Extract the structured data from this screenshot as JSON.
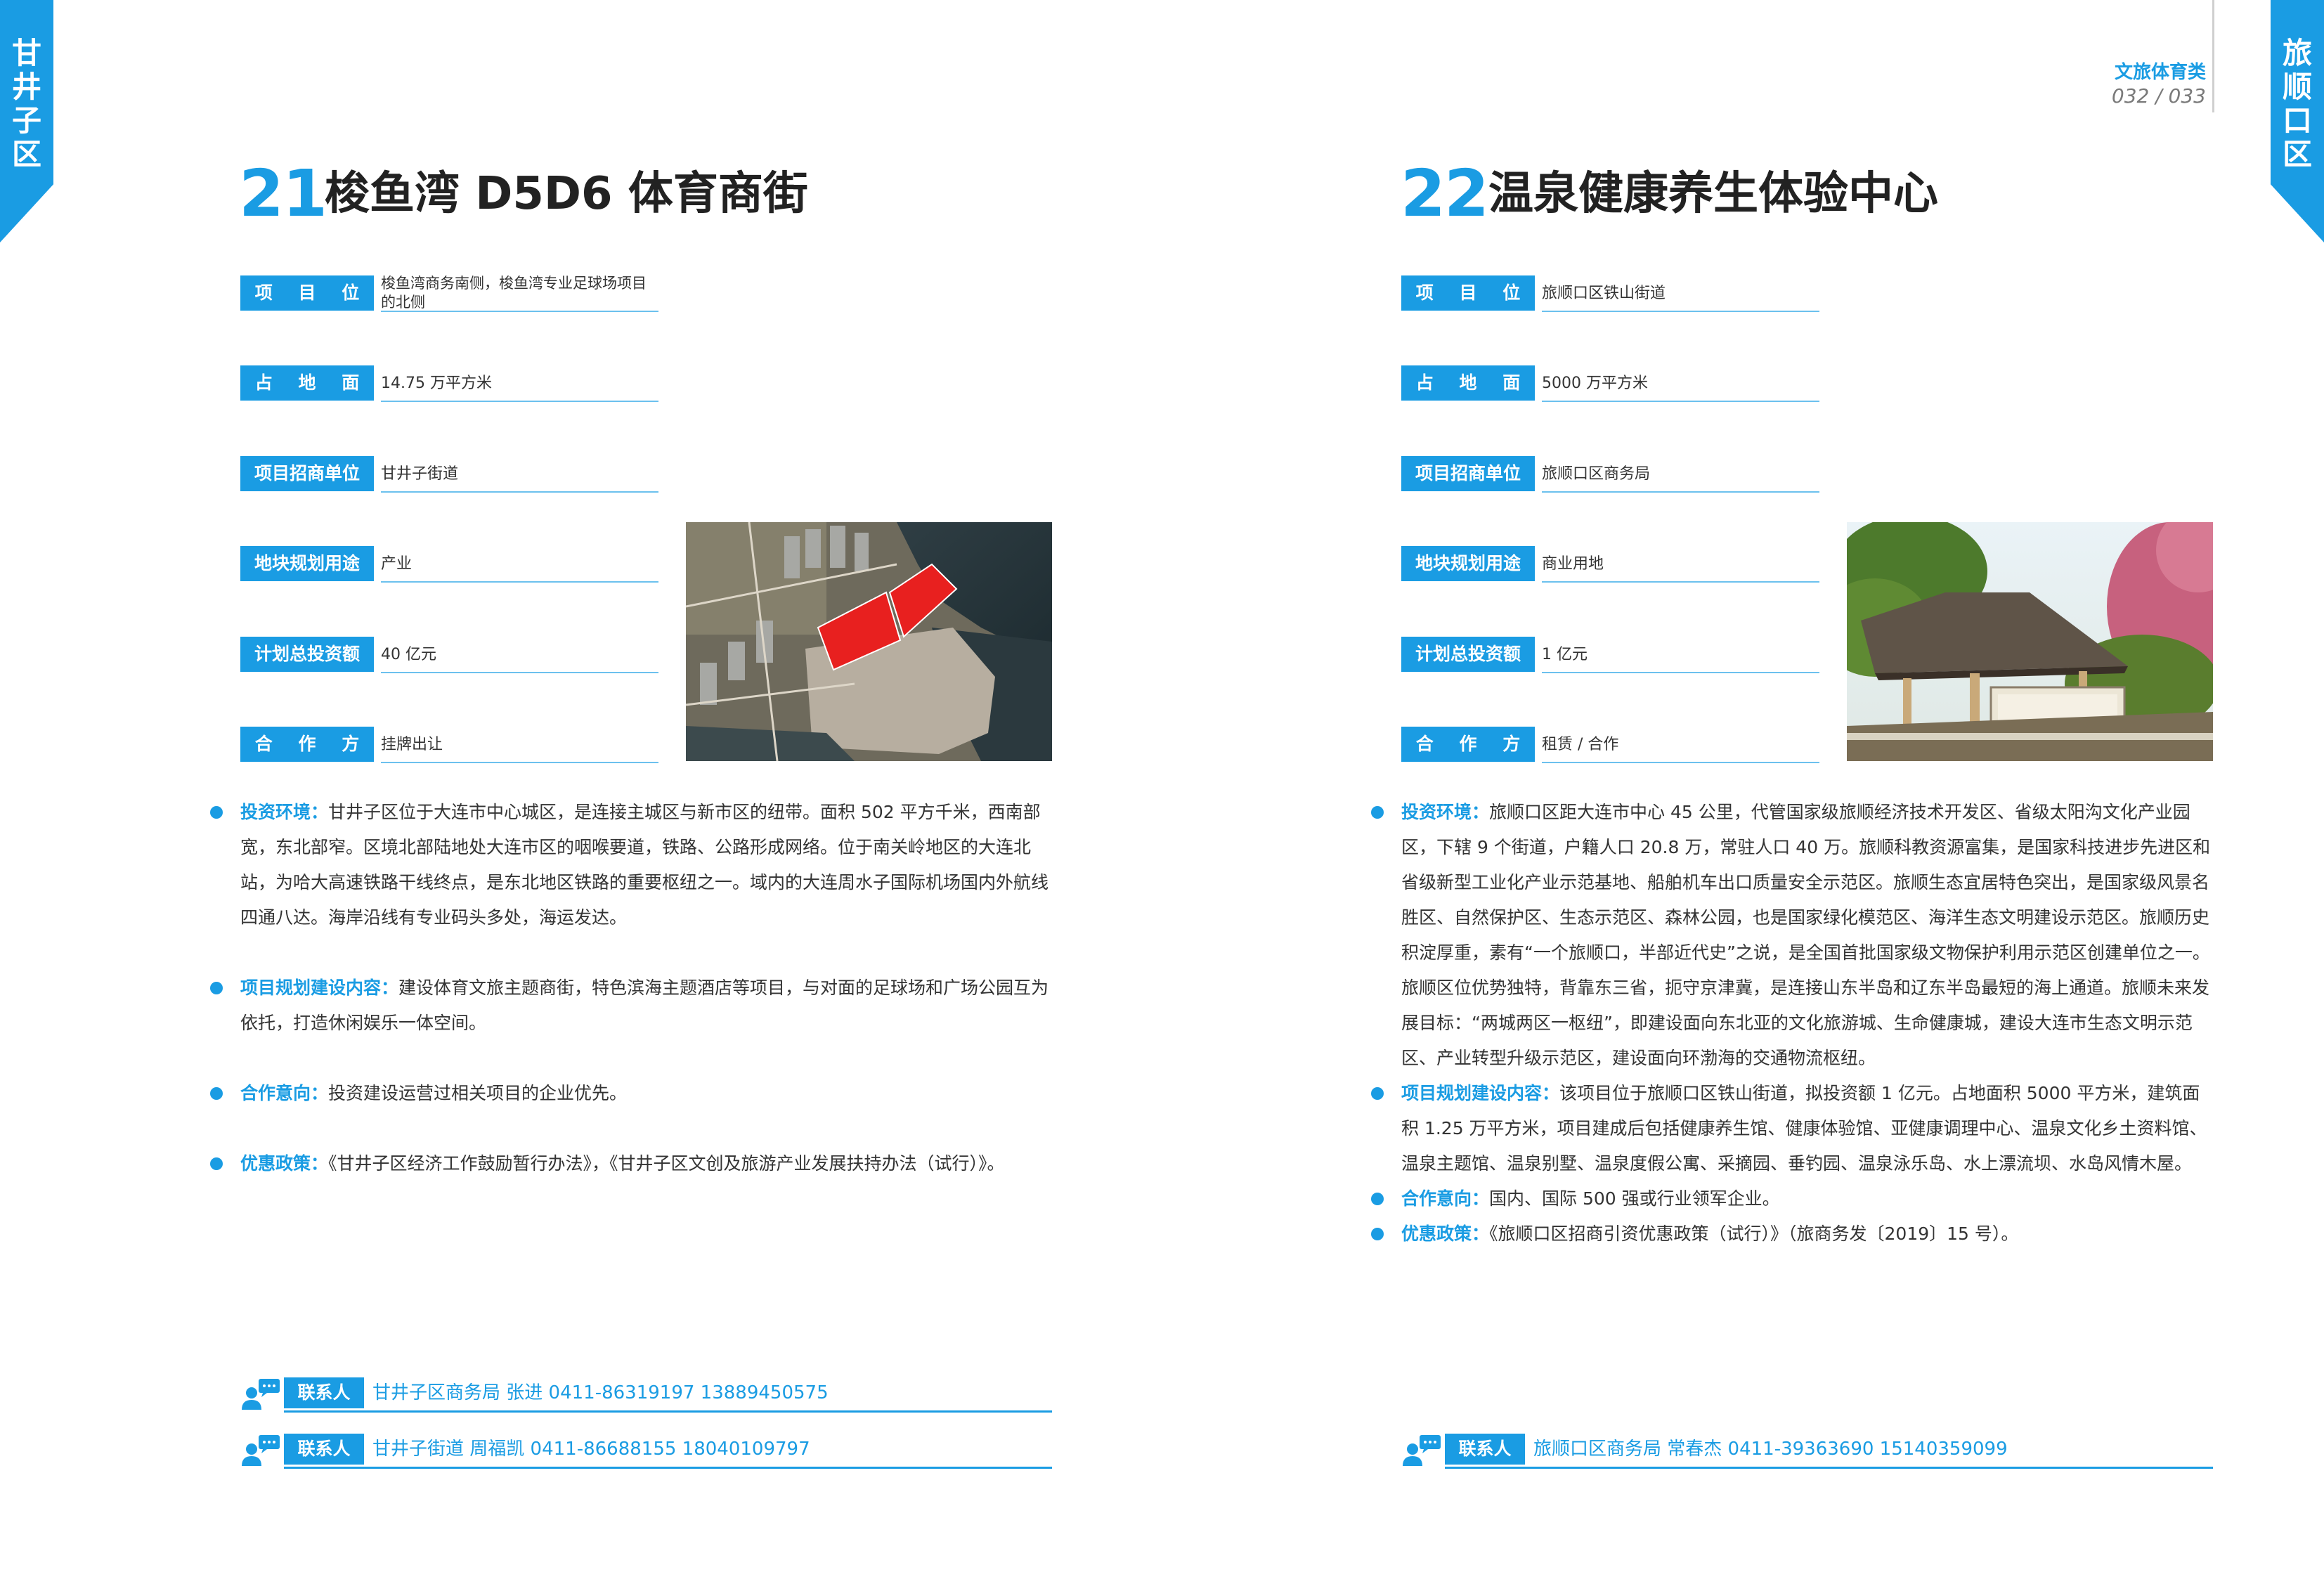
{
  "tabs": {
    "left": [
      "甘",
      "井",
      "子",
      "区"
    ],
    "right": [
      "旅",
      "顺",
      "口",
      "区"
    ]
  },
  "header": {
    "category": "文旅体育类",
    "page_numbers": "032 / 033"
  },
  "colors": {
    "accent": "#1a9ce3",
    "highlight_red": "#e8201f"
  },
  "left": {
    "number": "21",
    "title": "梭鱼湾 D5D6 体育商街",
    "rows": [
      {
        "label": "项 目 位 置",
        "value": "梭鱼湾商务南侧，梭鱼湾专业足球场项目的北侧"
      },
      {
        "label": "占 地 面 积",
        "value": "14.75 万平方米"
      },
      {
        "label": "项目招商单位",
        "value": "甘井子街道"
      },
      {
        "label": "地块规划用途",
        "value": "产业"
      },
      {
        "label": "计划总投资额",
        "value": "40 亿元"
      },
      {
        "label": "合 作 方 式",
        "value": "挂牌出让"
      }
    ],
    "bullets": [
      {
        "key": "投资环境：",
        "text": "甘井子区位于大连市中心城区，是连接主城区与新市区的纽带。面积 502 平方千米，西南部宽，东北部窄。区境北部陆地处大连市区的咽喉要道，铁路、公路形成网络。位于南关岭地区的大连北站，为哈大高速铁路干线终点，是东北地区铁路的重要枢纽之一。域内的大连周水子国际机场国内外航线四通八达。海岸沿线有专业码头多处，海运发达。"
      },
      {
        "key": "项目规划建设内容：",
        "text": "建设体育文旅主题商街，特色滨海主题酒店等项目，与对面的足球场和广场公园互为依托，打造休闲娱乐一体空间。"
      },
      {
        "key": "合作意向：",
        "text": "投资建设运营过相关项目的企业优先。"
      },
      {
        "key": "优惠政策：",
        "text": "《甘井子区经济工作鼓励暂行办法》，《甘井子区文创及旅游产业发展扶持办法（试行）》。"
      }
    ],
    "contacts": [
      {
        "label": "联系人",
        "text": "甘井子区商务局  张进  0411-86319197  13889450575"
      },
      {
        "label": "联系人",
        "text": "甘井子街道  周福凯  0411-86688155  18040109797"
      }
    ]
  },
  "right": {
    "number": "22",
    "title": "温泉健康养生体验中心",
    "rows": [
      {
        "label": "项 目 位 置",
        "value": "旅顺口区铁山街道"
      },
      {
        "label": "占 地 面 积",
        "value": "5000 万平方米"
      },
      {
        "label": "项目招商单位",
        "value": "旅顺口区商务局"
      },
      {
        "label": "地块规划用途",
        "value": "商业用地"
      },
      {
        "label": "计划总投资额",
        "value": "1 亿元"
      },
      {
        "label": "合 作 方 式",
        "value": "租赁 / 合作"
      }
    ],
    "bullets": [
      {
        "key": "投资环境：",
        "text": "旅顺口区距大连市中心 45 公里，代管国家级旅顺经济技术开发区、省级太阳沟文化产业园区，下辖 9 个街道，户籍人口 20.8 万，常驻人口 40 万。旅顺科教资源富集，是国家科技进步先进区和省级新型工业化产业示范基地、船舶机车出口质量安全示范区。旅顺生态宜居特色突出，是国家级风景名胜区、自然保护区、生态示范区、森林公园，也是国家绿化模范区、海洋生态文明建设示范区。旅顺历史积淀厚重，素有“一个旅顺口，半部近代史”之说，是全国首批国家级文物保护利用示范区创建单位之一。旅顺区位优势独特，背靠东三省，扼守京津冀，是连接山东半岛和辽东半岛最短的海上通道。旅顺未来发展目标：“两城两区一枢纽”，即建设面向东北亚的文化旅游城、生命健康城，建设大连市生态文明示范区、产业转型升级示范区，建设面向环渤海的交通物流枢纽。"
      },
      {
        "key": "项目规划建设内容：",
        "text": "该项目位于旅顺口区铁山街道，拟投资额 1 亿元。占地面积 5000 平方米，建筑面积 1.25 万平方米，项目建成后包括健康养生馆、健康体验馆、亚健康调理中心、温泉文化乡土资料馆、温泉主题馆、温泉别墅、温泉度假公寓、采摘园、垂钓园、温泉泳乐岛、水上漂流坝、水岛风情木屋。"
      },
      {
        "key": "合作意向：",
        "text": "国内、国际 500 强或行业领军企业。"
      },
      {
        "key": "优惠政策：",
        "text": "《旅顺口区招商引资优惠政策（试行）》（旅商务发〔2019〕15 号）。"
      }
    ],
    "contacts": [
      {
        "label": "联系人",
        "text": "旅顺口区商务局  常春杰  0411-39363690  15140359099"
      }
    ]
  }
}
